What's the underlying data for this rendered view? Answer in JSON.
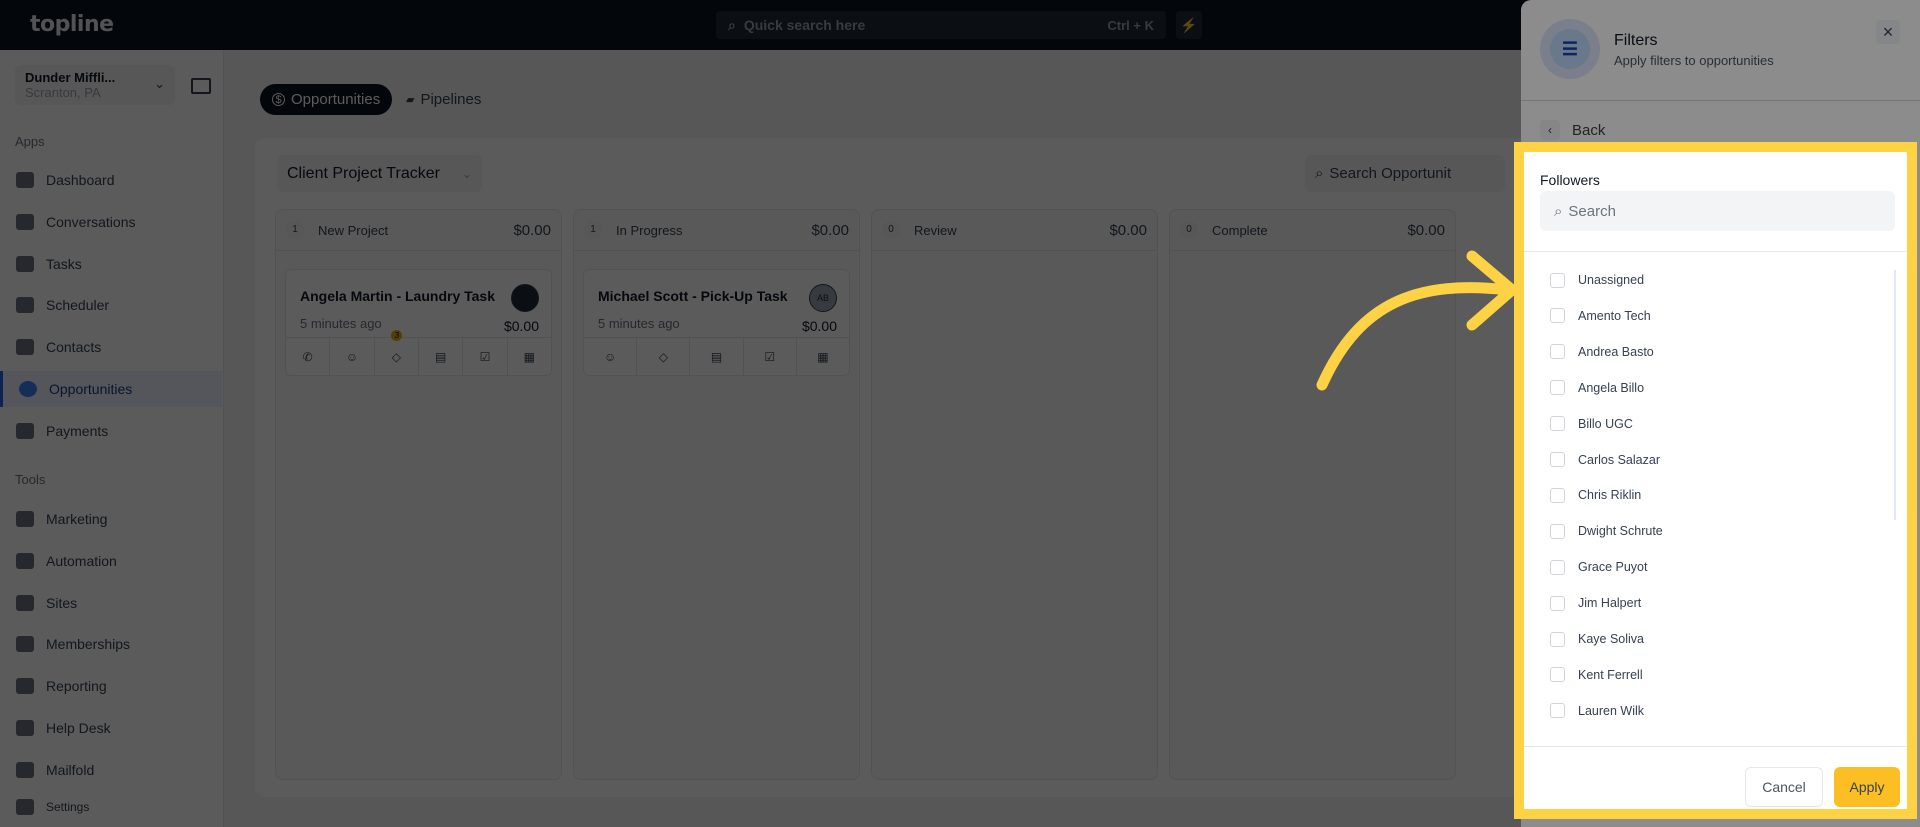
{
  "topbar": {
    "logo": "topline",
    "search_placeholder": "Quick search here",
    "shortcut": "Ctrl + K",
    "bolt_icon": "lightning-icon"
  },
  "sidebar": {
    "account": {
      "name": "Dunder Miffli...",
      "location": "Scranton, PA"
    },
    "apps_label": "Apps",
    "apps": [
      {
        "label": "Dashboard"
      },
      {
        "label": "Conversations"
      },
      {
        "label": "Tasks"
      },
      {
        "label": "Scheduler"
      },
      {
        "label": "Contacts"
      },
      {
        "label": "Opportunities",
        "active": true
      },
      {
        "label": "Payments"
      }
    ],
    "tools_label": "Tools",
    "tools": [
      {
        "label": "Marketing"
      },
      {
        "label": "Automation"
      },
      {
        "label": "Sites"
      },
      {
        "label": "Memberships"
      },
      {
        "label": "Reporting"
      },
      {
        "label": "Help Desk"
      },
      {
        "label": "Mailfold"
      }
    ],
    "settings": "Settings"
  },
  "main": {
    "tabs": [
      {
        "label": "Opportunities",
        "icon": "$"
      },
      {
        "label": "Pipelines"
      }
    ],
    "pipeline": "Client Project Tracker",
    "search_placeholder": "Search Opportunit",
    "columns": [
      {
        "count": "1",
        "name": "New Project",
        "amount": "$0.00",
        "card": {
          "title": "Angela Martin - Laundry Task",
          "time": "5 minutes ago",
          "value": "$0.00",
          "avatar": "",
          "tag_badge": "3"
        }
      },
      {
        "count": "1",
        "name": "In Progress",
        "amount": "$0.00",
        "card": {
          "title": "Michael Scott - Pick-Up Task",
          "time": "5 minutes ago",
          "value": "$0.00",
          "avatar": "AB"
        }
      },
      {
        "count": "0",
        "name": "Review",
        "amount": "$0.00"
      },
      {
        "count": "0",
        "name": "Complete",
        "amount": "$0.00"
      }
    ]
  },
  "filters": {
    "title": "Filters",
    "subtitle": "Apply filters to opportunities",
    "close": "×",
    "back": "Back",
    "section": "Followers",
    "search_placeholder": "Search",
    "options": [
      "Unassigned",
      "Amento Tech",
      "Andrea Basto",
      "Angela Billo",
      "Billo UGC",
      "Carlos Salazar",
      "Chris Riklin",
      "Dwight Schrute",
      "Grace Puyot",
      "Jim Halpert",
      "Kaye Soliva",
      "Kent Ferrell",
      "Lauren Wilk"
    ],
    "cancel": "Cancel",
    "apply": "Apply"
  },
  "colors": {
    "highlight": "#fdd244",
    "apply": "#fbbf24",
    "active": "#2563eb"
  }
}
